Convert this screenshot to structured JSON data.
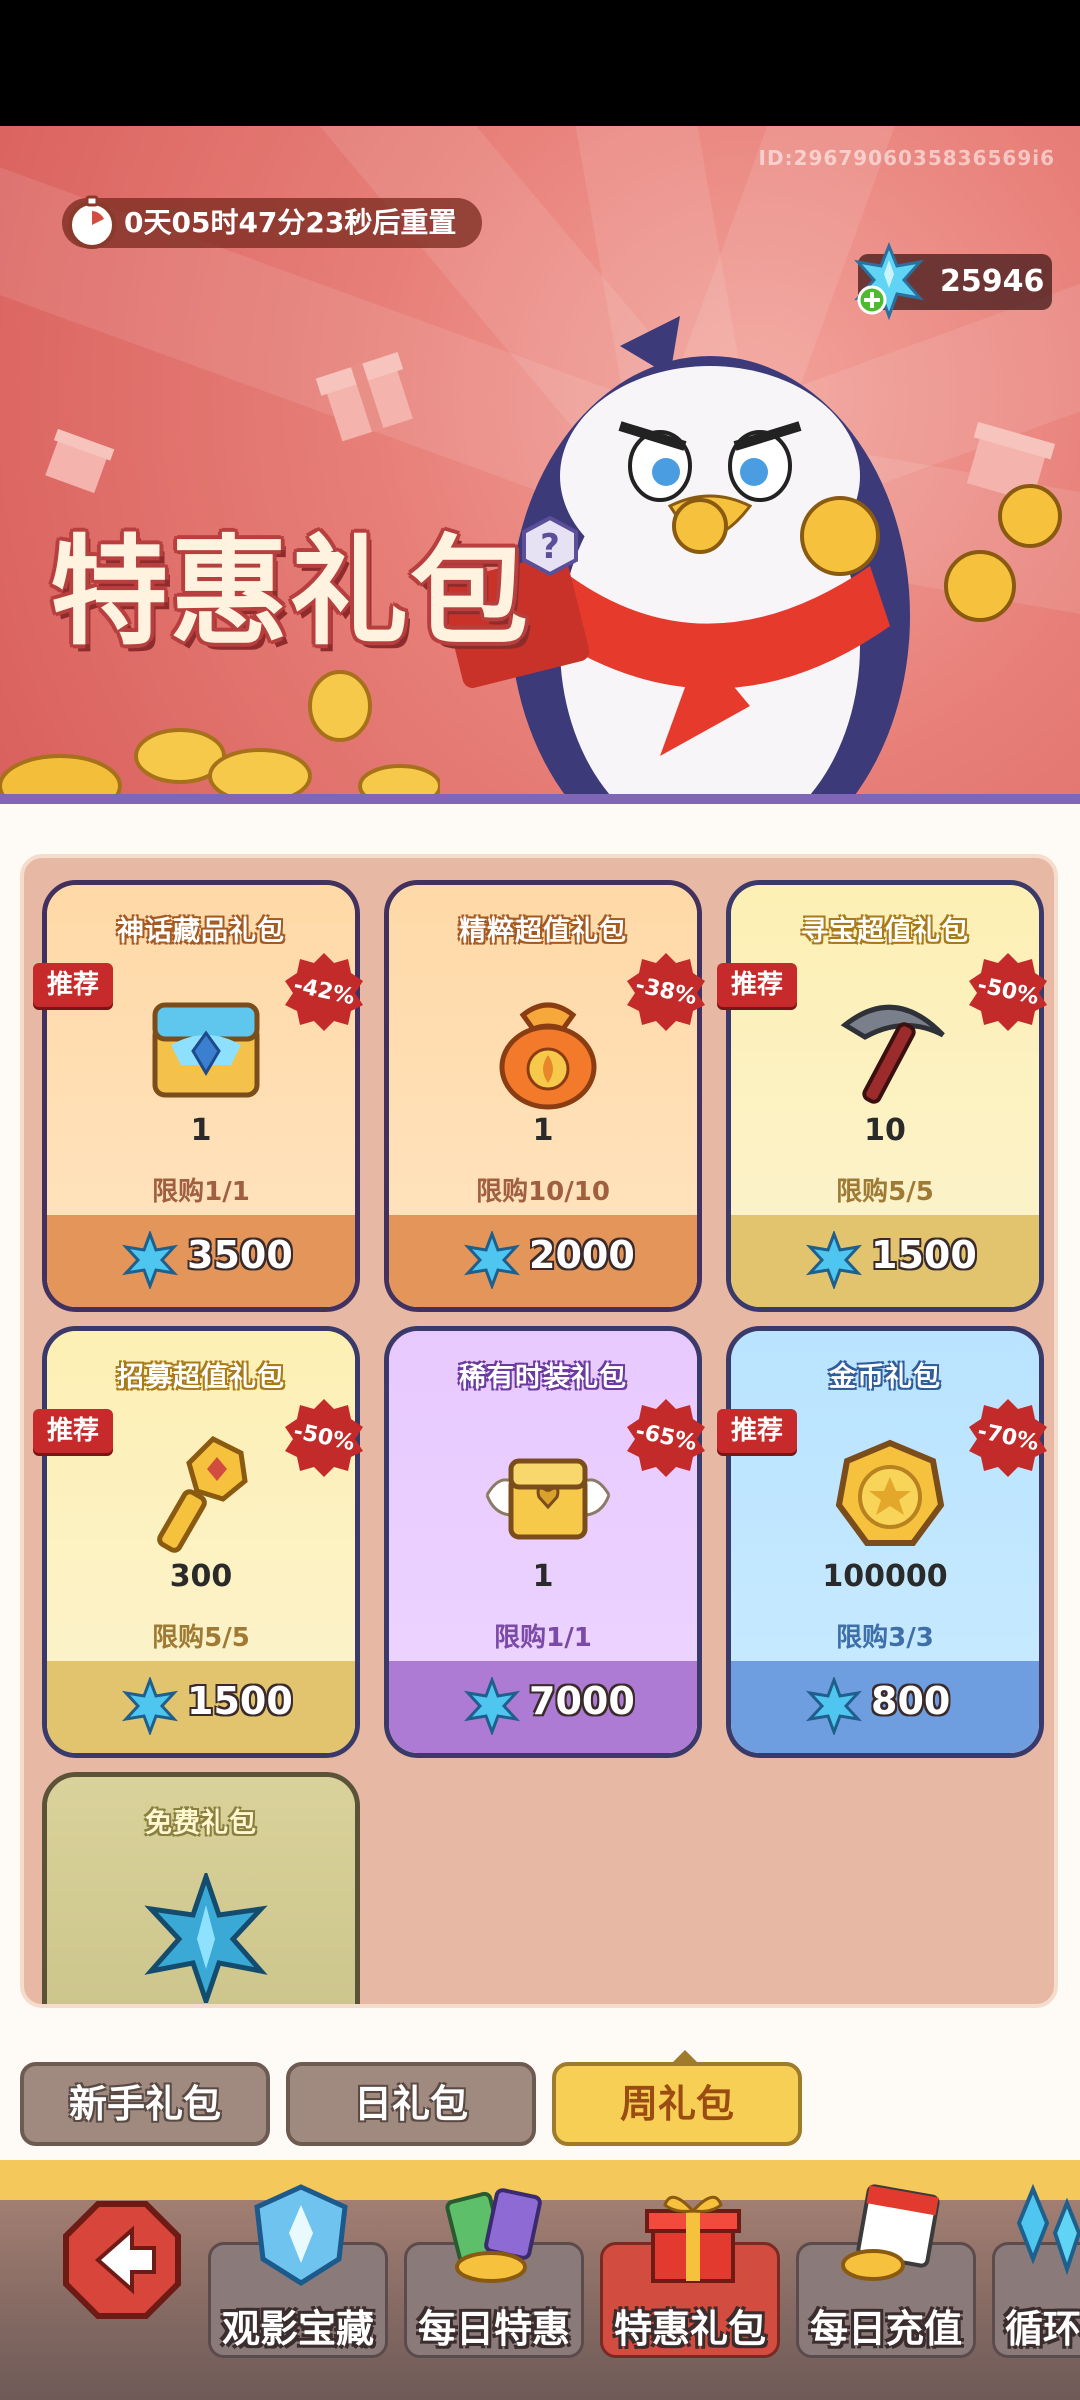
{
  "banner": {
    "uid": "ID:2967906035836569i6",
    "timer": "0天05时47分23秒后重置",
    "gems": "25946",
    "title": "特惠礼包"
  },
  "cards": [
    {
      "title": "神话藏品礼包",
      "tag": "推荐",
      "discount": "-42%",
      "qty": "1",
      "limit": "限购1/1",
      "price": "3500",
      "item_icon": "treasure-chest-icon"
    },
    {
      "title": "精粹超值礼包",
      "tag": "",
      "discount": "-38%",
      "qty": "1",
      "limit": "限购10/10",
      "price": "2000",
      "item_icon": "essence-bag-icon"
    },
    {
      "title": "寻宝超值礼包",
      "tag": "推荐",
      "discount": "-50%",
      "qty": "10",
      "limit": "限购5/5",
      "price": "1500",
      "item_icon": "pickaxe-icon"
    },
    {
      "title": "招募超值礼包",
      "tag": "推荐",
      "discount": "-50%",
      "qty": "300",
      "limit": "限购5/5",
      "price": "1500",
      "item_icon": "gold-key-icon"
    },
    {
      "title": "稀有时装礼包",
      "tag": "",
      "discount": "-65%",
      "qty": "1",
      "limit": "限购1/1",
      "price": "7000",
      "item_icon": "winged-chest-icon"
    },
    {
      "title": "金币礼包",
      "tag": "推荐",
      "discount": "-70%",
      "qty": "100000",
      "limit": "限购3/3",
      "price": "800",
      "item_icon": "gold-coin-icon"
    },
    {
      "title": "免费礼包",
      "item_icon": "blue-crystal-icon"
    }
  ],
  "subtabs": [
    "新手礼包",
    "日礼包",
    "周礼包"
  ],
  "active_subtab": "周礼包",
  "bottomnav": [
    "观影宝藏",
    "每日特惠",
    "特惠礼包",
    "每日充值",
    "循环"
  ],
  "active_nav": "特惠礼包",
  "colors": {
    "banner": "#e77f78",
    "panel_bg": "#e7b9a5",
    "price_gem": "#4ec6f0",
    "tag_red": "#c62a2a"
  }
}
